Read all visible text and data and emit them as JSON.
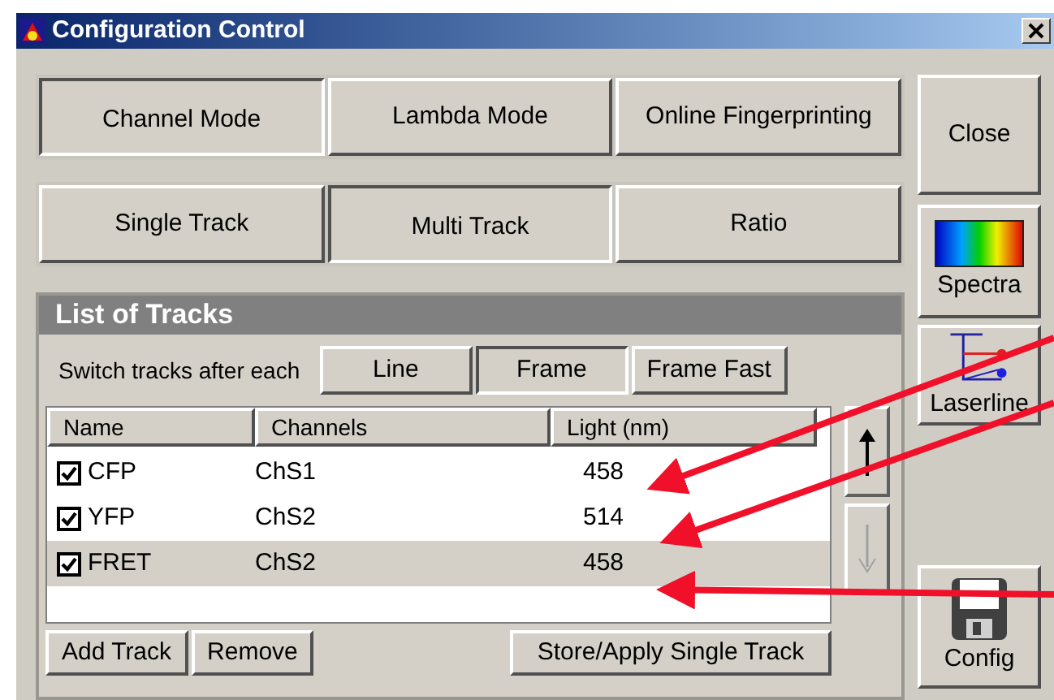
{
  "window": {
    "title": "Configuration Control"
  },
  "mode_tabs": [
    {
      "label": "Channel Mode",
      "selected": true
    },
    {
      "label": "Lambda Mode",
      "selected": false
    },
    {
      "label": "Online Fingerprinting",
      "selected": false
    }
  ],
  "track_tabs": [
    {
      "label": "Single Track",
      "selected": false
    },
    {
      "label": "Multi Track",
      "selected": true
    },
    {
      "label": "Ratio",
      "selected": false
    }
  ],
  "tracks_panel": {
    "title": "List of Tracks",
    "switch_label": "Switch tracks after each",
    "switch_options": [
      {
        "label": "Line",
        "selected": false
      },
      {
        "label": "Frame",
        "selected": true
      },
      {
        "label": "Frame Fast",
        "selected": false
      }
    ],
    "columns": [
      "Name",
      "Channels",
      "Light (nm)"
    ],
    "rows": [
      {
        "checked": true,
        "selected": false,
        "cells": [
          "CFP",
          "ChS1",
          "458"
        ]
      },
      {
        "checked": true,
        "selected": false,
        "cells": [
          "YFP",
          "ChS2",
          "514"
        ]
      },
      {
        "checked": true,
        "selected": true,
        "cells": [
          "FRET",
          "ChS2",
          "458"
        ]
      }
    ],
    "move_up": {
      "disabled": false
    },
    "move_down": {
      "disabled": true
    },
    "buttons": [
      "Add Track",
      "Remove",
      "Store/Apply Single Track"
    ]
  },
  "side_buttons": [
    {
      "kind": "text",
      "label": "Close"
    },
    {
      "kind": "spectra",
      "label": "Spectra"
    },
    {
      "kind": "laserline",
      "label": "Laserline"
    },
    {
      "kind": "config",
      "label": "Config"
    }
  ]
}
